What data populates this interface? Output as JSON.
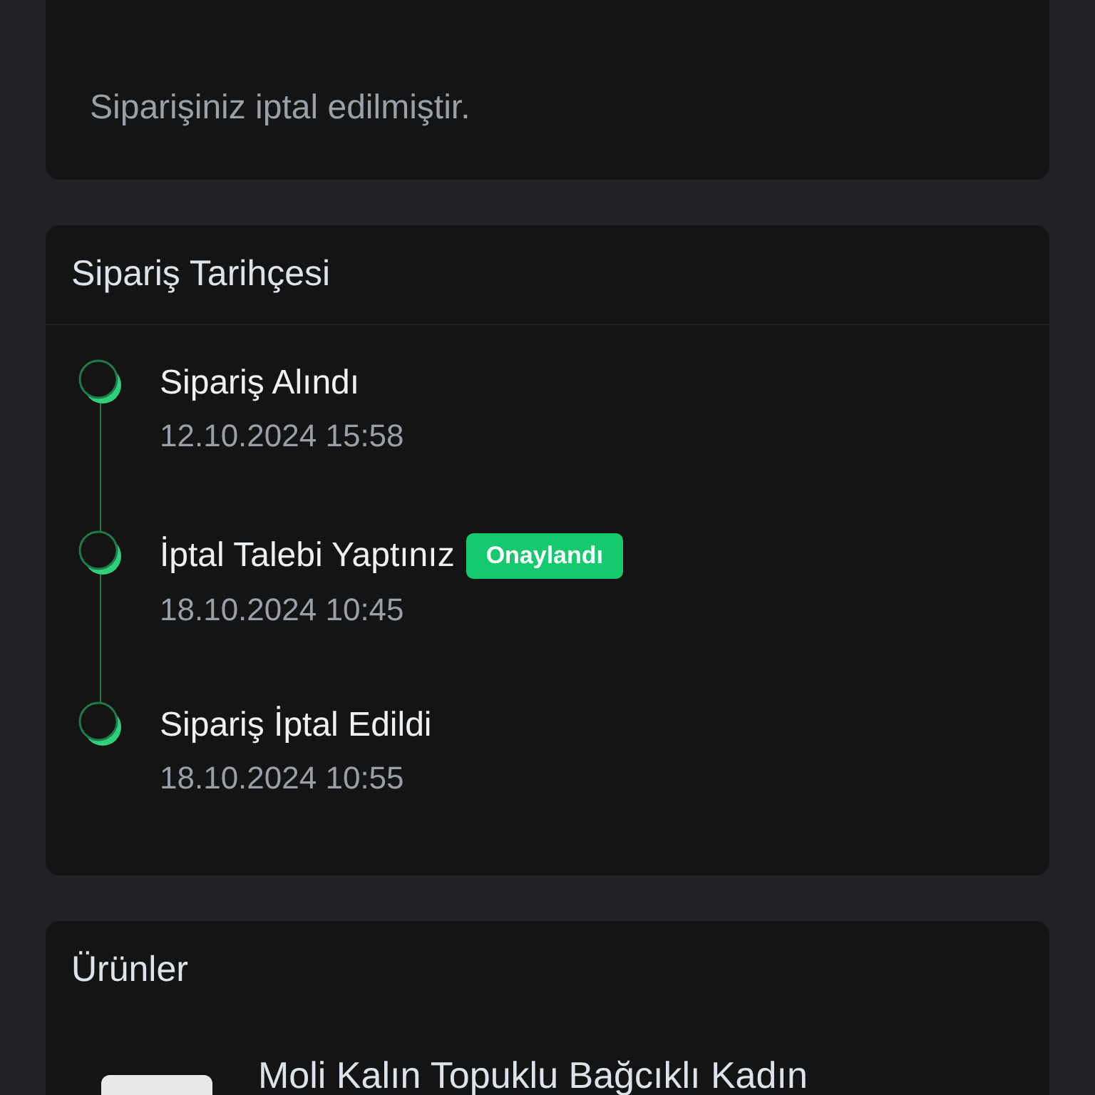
{
  "cancel_notice": {
    "message": "Siparişiniz iptal edilmiştir."
  },
  "order_history": {
    "title": "Sipariş Tarihçesi",
    "events": [
      {
        "title": "Sipariş Alındı",
        "date": "12.10.2024 15:58"
      },
      {
        "title": "İptal Talebi Yaptınız",
        "badge": "Onaylandı",
        "date": "18.10.2024 10:45"
      },
      {
        "title": "Sipariş İptal Edildi",
        "date": "18.10.2024 10:55"
      }
    ]
  },
  "products": {
    "title": "Ürünler",
    "items": [
      {
        "kind": "picture",
        "name": "Moli Kalın Topuklu Bağcıklı Kadın"
      }
    ]
  }
}
